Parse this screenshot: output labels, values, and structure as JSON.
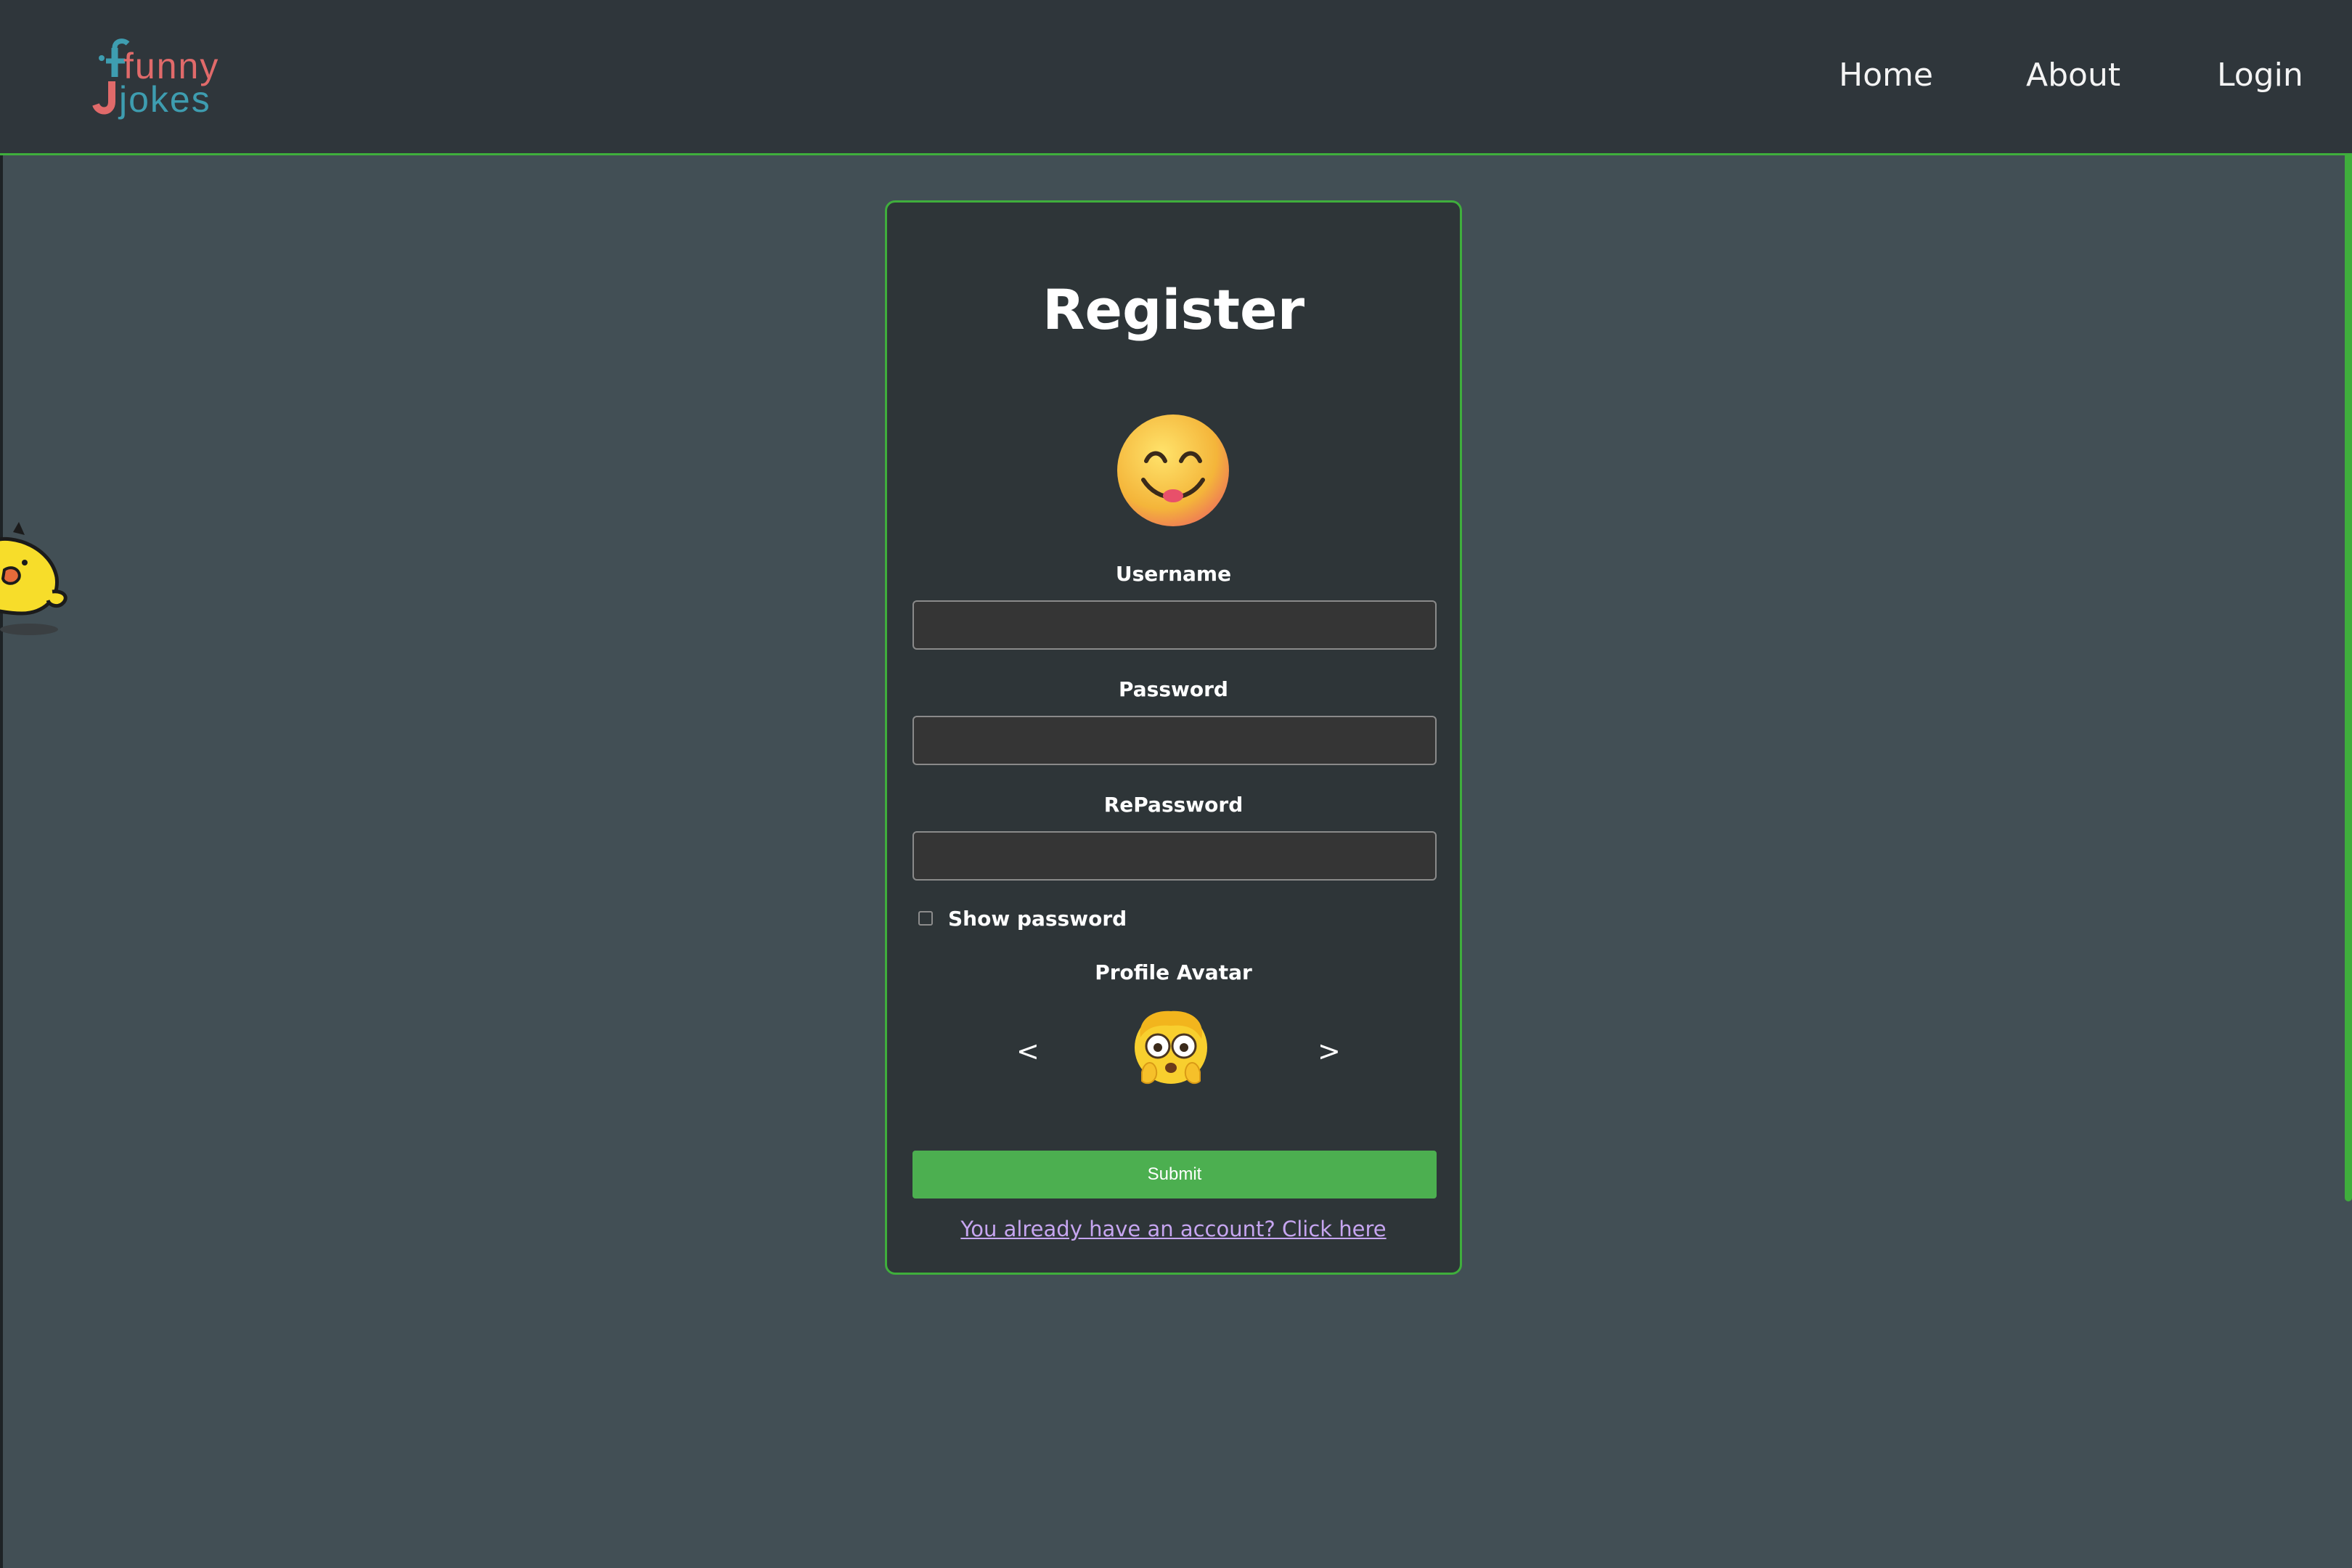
{
  "header": {
    "logo_line1": "funny",
    "logo_line2": "jokes",
    "nav": {
      "home": "Home",
      "about": "About",
      "login": "Login"
    }
  },
  "form": {
    "title": "Register",
    "hero_icon": "smiling-face-emoji",
    "username_label": "Username",
    "username_value": "",
    "password_label": "Password",
    "password_value": "",
    "repassword_label": "RePassword",
    "repassword_value": "",
    "show_password_label": "Show password",
    "show_password_checked": false,
    "avatar_label": "Profile Avatar",
    "avatar_prev": "<",
    "avatar_next": ">",
    "avatar_icon": "flushed-face-emoji",
    "submit_label": "Submit",
    "login_link": "You already have an account? Click here"
  },
  "colors": {
    "background": "#424f55",
    "header": "#2f363b",
    "accent_green": "#3fae3c",
    "submit_green": "#4caf50",
    "link_purple": "#c6a5f0",
    "logo_red": "#e06a6a",
    "logo_teal": "#3e9db0"
  },
  "decorations": {
    "side_mascot": "yellow-chick-icon"
  }
}
